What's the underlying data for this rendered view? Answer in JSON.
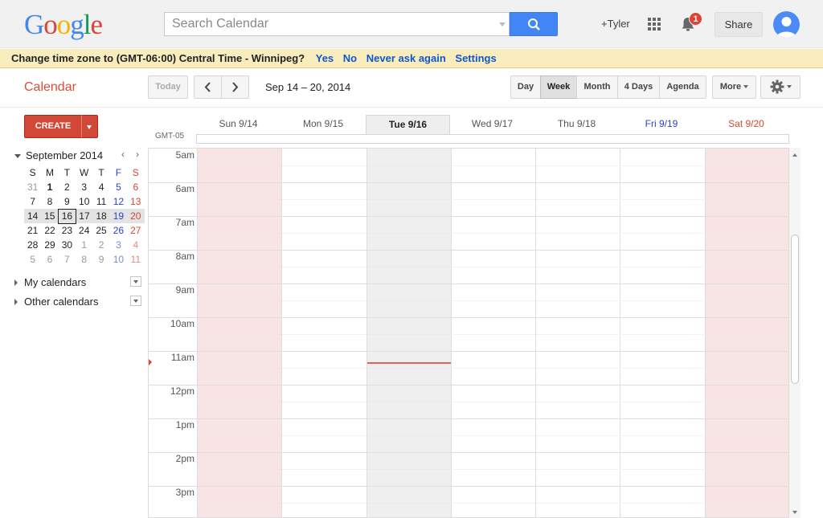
{
  "header": {
    "logo": [
      "G",
      "o",
      "o",
      "g",
      "l",
      "e"
    ],
    "logo_colors": [
      "#4285f4",
      "#db4437",
      "#f4b400",
      "#4285f4",
      "#0f9d58",
      "#db4437"
    ],
    "search_placeholder": "Search Calendar",
    "user_link": "+Tyler",
    "notification_count": "1",
    "share_label": "Share",
    "accent": "#4285f4"
  },
  "banner": {
    "message": "Change time zone to (GMT-06:00) Central Time - Winnipeg?",
    "yes": "Yes",
    "no": "No",
    "never": "Never ask again",
    "settings": "Settings"
  },
  "toolbar": {
    "app_title": "Calendar",
    "today_label": "Today",
    "date_range": "Sep 14 – 20, 2014",
    "views": {
      "day": "Day",
      "week": "Week",
      "month": "Month",
      "four_days": "4 Days",
      "agenda": "Agenda",
      "more": "More"
    },
    "selected_view": "Week"
  },
  "sidebar": {
    "create_label": "CREATE",
    "mini_calendar": {
      "title": "September 2014",
      "weekdays": [
        "S",
        "M",
        "T",
        "W",
        "T",
        "F",
        "S"
      ],
      "weeks": [
        [
          "31",
          "1",
          "2",
          "3",
          "4",
          "5",
          "6"
        ],
        [
          "7",
          "8",
          "9",
          "10",
          "11",
          "12",
          "13"
        ],
        [
          "14",
          "15",
          "16",
          "17",
          "18",
          "19",
          "20"
        ],
        [
          "21",
          "22",
          "23",
          "24",
          "25",
          "26",
          "27"
        ],
        [
          "28",
          "29",
          "30",
          "1",
          "2",
          "3",
          "4"
        ],
        [
          "5",
          "6",
          "7",
          "8",
          "9",
          "10",
          "11"
        ]
      ],
      "today": "16"
    },
    "my_calendars": "My calendars",
    "other_calendars": "Other calendars"
  },
  "week": {
    "timezone_label": "GMT-05",
    "days": [
      "Sun 9/14",
      "Mon 9/15",
      "Tue 9/16",
      "Wed 9/17",
      "Thu 9/18",
      "Fri 9/19",
      "Sat 9/20"
    ],
    "today_index": 2,
    "hours": [
      "5am",
      "6am",
      "7am",
      "8am",
      "9am",
      "10am",
      "11am",
      "12pm",
      "1pm",
      "2pm",
      "3pm"
    ],
    "now_color": "#e53a2d"
  }
}
